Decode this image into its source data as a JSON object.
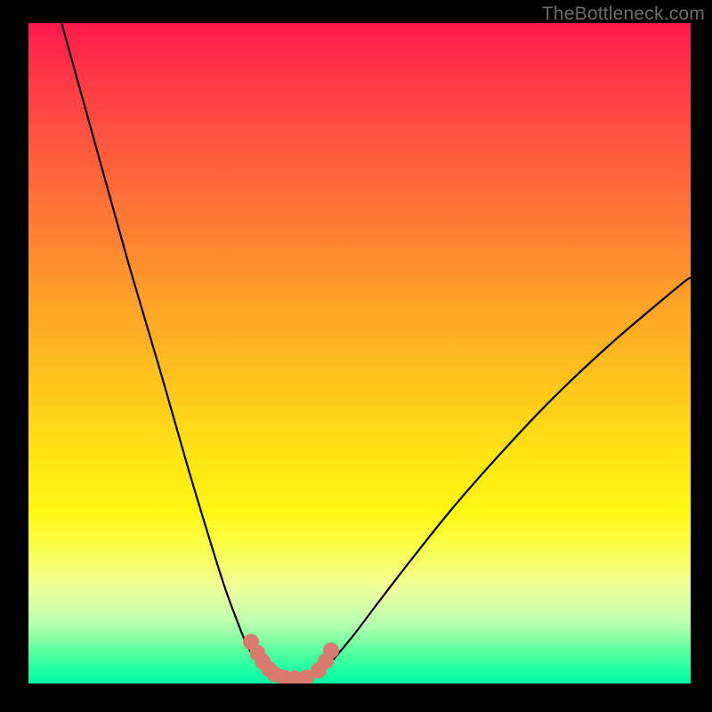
{
  "watermark": "TheBottleneck.com",
  "chart_data": {
    "type": "line",
    "title": "",
    "xlabel": "",
    "ylabel": "",
    "xlim": [
      0,
      100
    ],
    "ylim": [
      0,
      100
    ],
    "series": [
      {
        "name": "left-branch",
        "x": [
          5,
          10,
          15,
          20,
          24,
          27,
          29.5,
          31.5,
          33,
          34.5,
          36
        ],
        "y": [
          100,
          82,
          64,
          47,
          33,
          23,
          15,
          9.5,
          5.8,
          3.3,
          1.4
        ]
      },
      {
        "name": "right-branch",
        "x": [
          44,
          46,
          49,
          53,
          58,
          64,
          71,
          79,
          88,
          98,
          100
        ],
        "y": [
          1.4,
          3.6,
          7.2,
          12.5,
          19,
          26.5,
          34.5,
          43,
          51.5,
          60,
          61.5
        ]
      },
      {
        "name": "trough-dots-left",
        "x": [
          33.6,
          34.6,
          35.4,
          36.3,
          37.2,
          38.6,
          40.2
        ],
        "y": [
          6.3,
          4.6,
          3.3,
          2.2,
          1.4,
          0.9,
          0.8
        ]
      },
      {
        "name": "trough-dots-right",
        "x": [
          42.0,
          43.8,
          44.9,
          45.7
        ],
        "y": [
          0.9,
          2.0,
          3.4,
          5.0
        ]
      }
    ],
    "colors": {
      "curve": "#000000",
      "dots": "#d87a6e"
    }
  }
}
